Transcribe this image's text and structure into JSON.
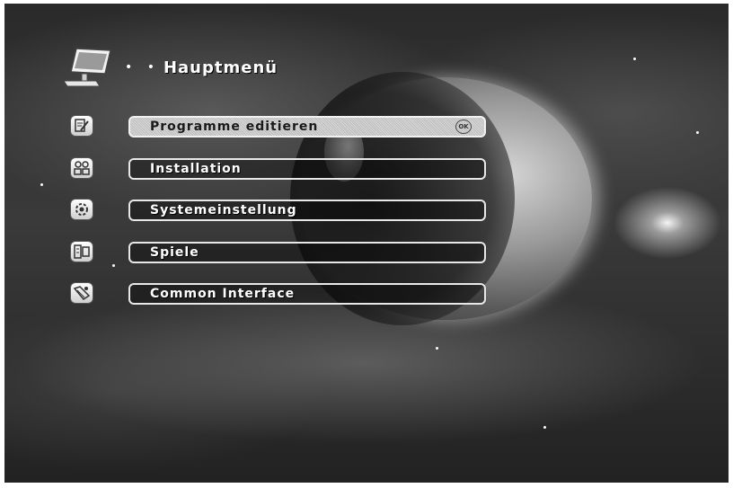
{
  "header": {
    "title": "Hauptmenü",
    "decoration": "• •",
    "icon": "monitor-icon"
  },
  "menu": {
    "selected_index": 0,
    "ok_badge": "OK",
    "items": [
      {
        "label": "Programme editieren",
        "icon": "edit-icon"
      },
      {
        "label": "Installation",
        "icon": "installation-icon"
      },
      {
        "label": "Systemeinstellung",
        "icon": "settings-icon"
      },
      {
        "label": "Spiele",
        "icon": "games-icon"
      },
      {
        "label": "Common Interface",
        "icon": "common-interface-icon"
      }
    ]
  },
  "colors": {
    "text": "#ffffff",
    "selected_text": "#1a1a1a",
    "border": "#e8e8e8"
  }
}
